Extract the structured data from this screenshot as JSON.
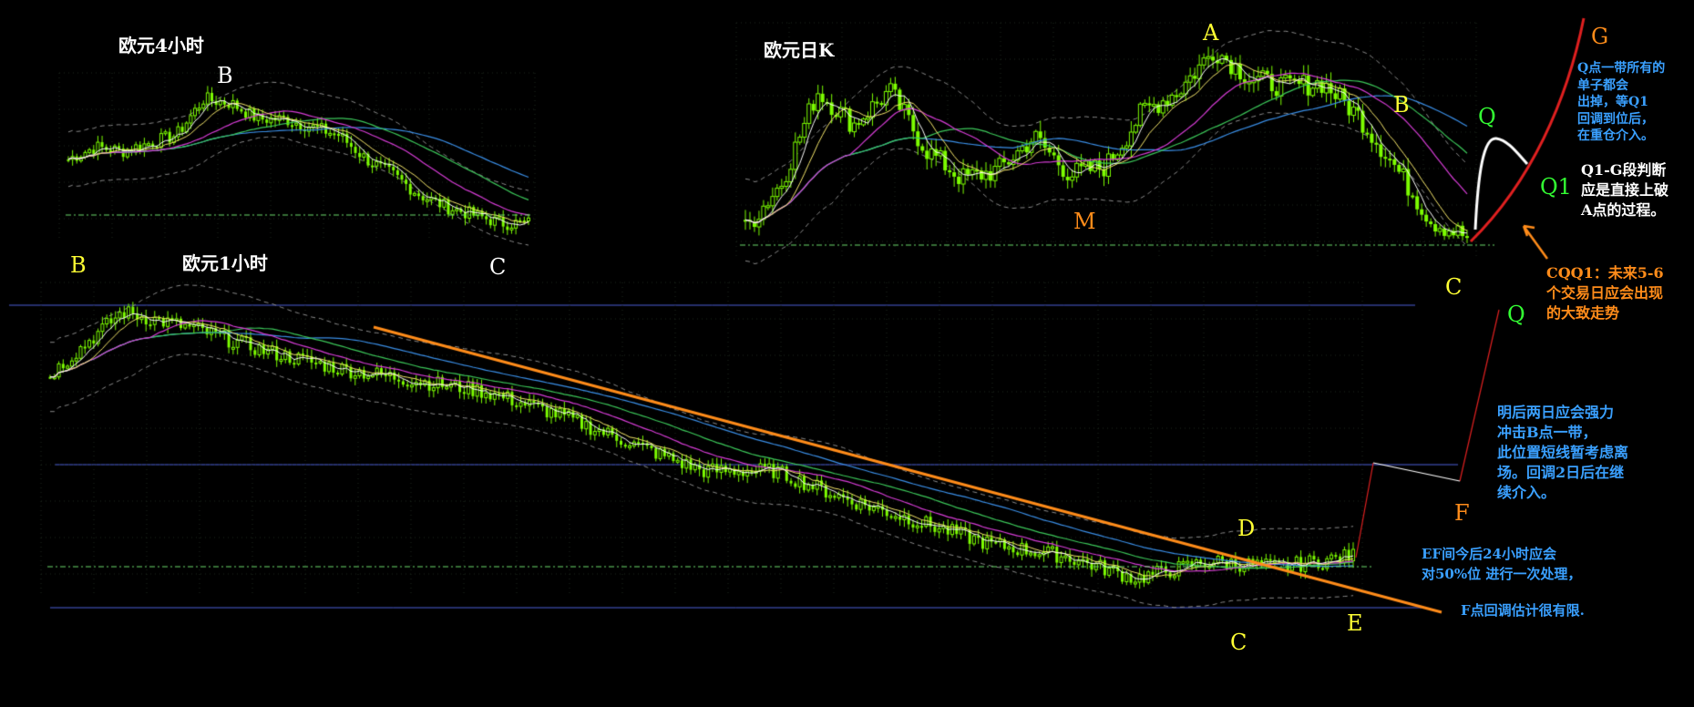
{
  "panels": {
    "h4": {
      "title": "欧元4小时"
    },
    "daily": {
      "title": "欧元日K"
    },
    "h1": {
      "title": "欧元1小时"
    }
  },
  "points": {
    "h4_B": "B",
    "h4_C": "C",
    "d_A": "A",
    "d_M": "M",
    "d_B": "B",
    "d_C": "C",
    "d_G": "G",
    "d_Q": "Q",
    "d_Q1": "Q1",
    "h1_B": "B",
    "h1_C": "C",
    "h1_D": "D",
    "h1_E": "E",
    "h1_F": "F",
    "h1_Q": "Q"
  },
  "notes": {
    "q_exit": [
      "Q点一带所有的",
      "单子都会",
      "出掉，等Q1",
      "回调到位后，",
      "在重仓介入。"
    ],
    "q1g": [
      "Q1-G段判断",
      "应是直接上破",
      "A点的过程。"
    ],
    "cqq1": [
      "CQQ1：未来5-6",
      "个交易日应会出现",
      "的大致走势"
    ],
    "b_area": [
      "明后两日应会强力",
      "冲击B点一带，",
      "此位置短线暂考虑离",
      "场。回调2日后在继",
      "续介入。"
    ],
    "ef": [
      "EF间今后24小时应会",
      "对50%位 进行一次处理，"
    ],
    "f_retrace": [
      "F点回调估计很有限."
    ]
  },
  "colors": {
    "background": "#000000",
    "candle": "#7cfc00",
    "ma_short": "#ffffff",
    "ma_mid": "#f5e66b",
    "ma_magenta": "#d63cd6",
    "ma_green": "#3cc85a",
    "ma_blue": "#3a8ee6",
    "bands": "#8a8a8a",
    "level": "#4d5fd9",
    "trendline": "#ff8c1a",
    "fib": "#6ddc6d",
    "red_projection": "#e02020",
    "note_blue": "#3aa0ff",
    "note_orange": "#ff8c1a",
    "point_yellow": "#ffff33",
    "point_green": "#33ff33"
  },
  "chart_data": [
    {
      "type": "candlestick",
      "title": "欧元4小时",
      "trend": "down",
      "close_path": [
        1.6,
        1.9,
        1.8,
        2.0,
        2.2,
        3.1,
        3.0,
        2.6,
        2.6,
        2.4,
        2.2,
        1.6,
        1.2,
        0.7,
        0.4,
        0.2,
        0.0,
        0.0
      ],
      "annotations": [
        "B",
        "C"
      ]
    },
    {
      "type": "candlestick",
      "title": "欧元日K",
      "close_path": [
        0.3,
        1.4,
        3.6,
        2.8,
        3.6,
        2.2,
        1.5,
        1.7,
        2.5,
        1.6,
        1.8,
        3.1,
        3.6,
        4.6,
        3.9,
        3.7,
        3.8,
        3.0,
        1.8,
        0.5,
        0.1
      ],
      "projection": [
        0.1,
        1.8,
        2.0,
        1.6,
        1.2
      ],
      "annotations": [
        "A",
        "M",
        "B",
        "C",
        "G",
        "Q",
        "Q1"
      ]
    },
    {
      "type": "candlestick",
      "title": "欧元1小时",
      "close_path": [
        3.6,
        4.7,
        4.4,
        4.0,
        3.7,
        3.5,
        3.3,
        2.9,
        2.4,
        1.9,
        1.9,
        1.4,
        1.0,
        0.6,
        0.4,
        0.0,
        0.3,
        0.2,
        0.4
      ],
      "projection": [
        0.4,
        1.9,
        1.8,
        4.6
      ],
      "annotations": [
        "B",
        "C",
        "D",
        "E",
        "F",
        "Q"
      ]
    }
  ]
}
